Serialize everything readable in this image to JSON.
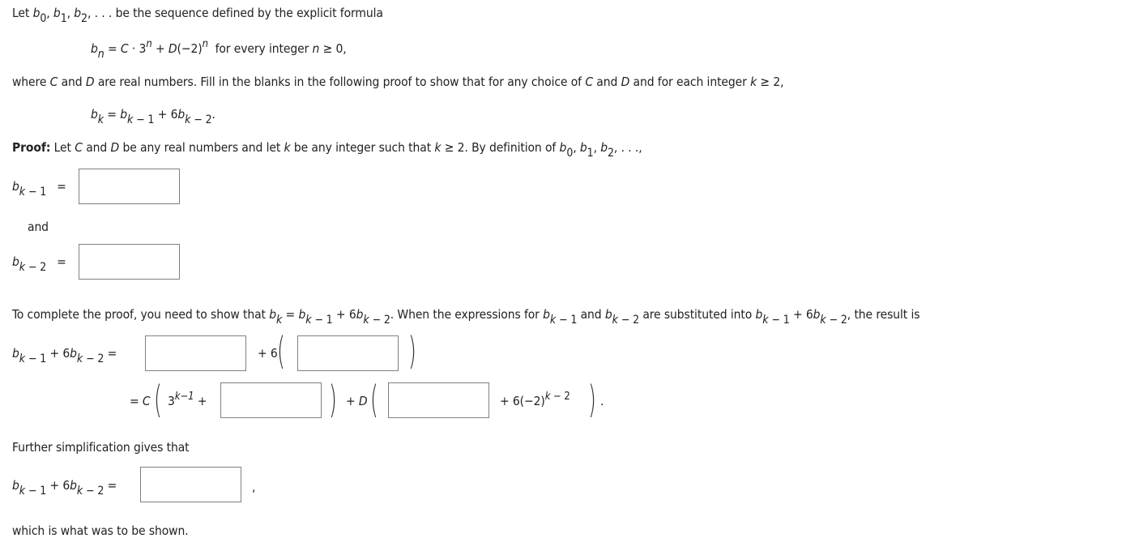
{
  "intro": {
    "let": "Let",
    "seq_tail": ". . . be the sequence defined by the explicit formula",
    "formula_rest": "for every integer",
    "formula_cond": "n ≥ 0,",
    "where": "where",
    "where_mid1": "and",
    "where_mid2": "are real numbers. Fill in the blanks in the following proof to show that for any choice of",
    "where_mid3": "and",
    "where_mid4": "and for each integer",
    "where_end": "k ≥ 2,"
  },
  "proof": {
    "label": "Proof:",
    "text1": "Let",
    "text2": "and",
    "text3": "be any real numbers and let",
    "text4": "be any integer such that",
    "text5": "k",
    "text6": "≥ 2. By definition of",
    "and_label": "and",
    "complete_text": "To complete the proof, you need to show that",
    "when_text": "When the expressions for",
    "and_text": "and",
    "substituted_text": "are substituted into",
    "result_text": "the result is",
    "further_text": "Further simplification gives that",
    "conclusion": "which is what was to be shown."
  },
  "inputs": {
    "b_k_minus_1": "",
    "b_k_minus_2": "",
    "sum_term1": "",
    "sum_term2": "",
    "c_term": "",
    "d_term": "",
    "final": ""
  }
}
